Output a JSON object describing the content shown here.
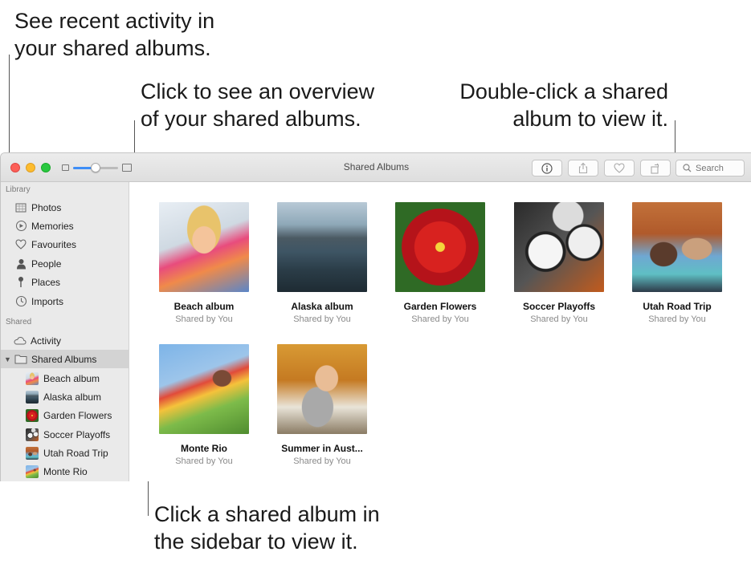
{
  "callouts": {
    "activity": [
      "See recent activity in",
      "your shared albums."
    ],
    "overview": [
      "Click to see an overview",
      "of your shared albums."
    ],
    "double_click": [
      "Double-click a shared",
      "album to view it."
    ],
    "sidebar_click": [
      "Click a shared album in",
      "the sidebar to view it."
    ]
  },
  "window": {
    "title": "Shared Albums",
    "zoom_level": 0.5,
    "search_placeholder": "Search"
  },
  "toolbar": {
    "icons": [
      "info-icon",
      "share-icon",
      "heart-icon",
      "rotate-icon"
    ]
  },
  "sidebar": {
    "library_header": "Library",
    "library_items": [
      {
        "label": "Photos",
        "icon": "photos-icon"
      },
      {
        "label": "Memories",
        "icon": "memories-icon"
      },
      {
        "label": "Favourites",
        "icon": "heart-icon"
      },
      {
        "label": "People",
        "icon": "person-icon"
      },
      {
        "label": "Places",
        "icon": "pin-icon"
      },
      {
        "label": "Imports",
        "icon": "clock-icon"
      }
    ],
    "shared_header": "Shared",
    "activity": "Activity",
    "shared_albums": "Shared Albums",
    "albums": [
      "Beach album",
      "Alaska album",
      "Garden Flowers",
      "Soccer Playoffs",
      "Utah Road Trip",
      "Monte Rio"
    ]
  },
  "albums": [
    {
      "name": "Beach album",
      "sub": "Shared by You"
    },
    {
      "name": "Alaska album",
      "sub": "Shared by You"
    },
    {
      "name": "Garden Flowers",
      "sub": "Shared by You"
    },
    {
      "name": "Soccer Playoffs",
      "sub": "Shared by You"
    },
    {
      "name": "Utah Road Trip",
      "sub": "Shared by You"
    },
    {
      "name": "Monte Rio",
      "sub": "Shared by You"
    },
    {
      "name": "Summer in Aust...",
      "sub": "Shared by You"
    }
  ]
}
